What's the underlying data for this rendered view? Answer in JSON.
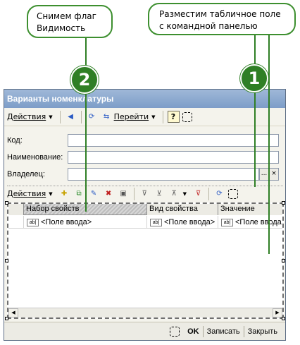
{
  "callouts": {
    "left": {
      "line1": "Снимем флаг",
      "line2": "Видимость"
    },
    "right": {
      "line1": "Разместим табличное поле",
      "line2": "с командной панелью"
    }
  },
  "badges": {
    "one": "1",
    "two": "2"
  },
  "window": {
    "title": "Варианты номенклатуры",
    "toolbar": {
      "actions": "Действия",
      "goto": "Перейти",
      "help": "?"
    },
    "form": {
      "code_label": "Код:",
      "name_label": "Наименование:",
      "owner_label": "Владелец:",
      "owner_select_btn": "...",
      "owner_clear_btn": "×"
    },
    "table_toolbar": {
      "actions": "Действия"
    },
    "grid": {
      "columns": [
        "Набор свойств",
        "Вид свойства",
        "Значение"
      ],
      "row": {
        "icon": "ab|",
        "cells": [
          "<Поле ввода>",
          "<Поле ввода>",
          "<Поле ввода"
        ]
      }
    },
    "footer": {
      "ok": "OK",
      "save": "Записать",
      "close": "Закрыть"
    }
  },
  "colors": {
    "accent_green": "#2f7f25",
    "title_blue": "#7d9dc8"
  }
}
